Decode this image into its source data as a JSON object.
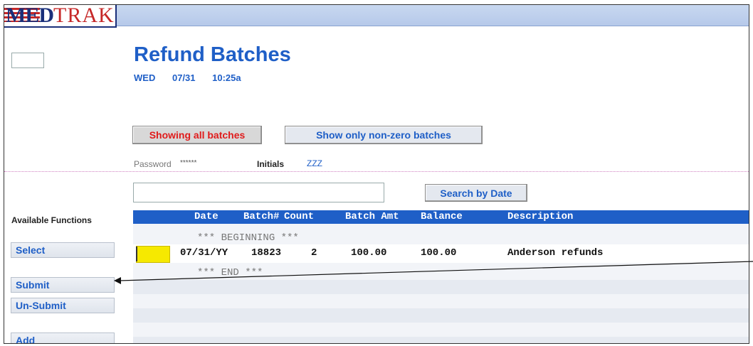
{
  "app": {
    "logo_med": "MED",
    "logo_trak": "TRAK"
  },
  "page": {
    "title": "Refund Batches",
    "day": "WED",
    "date": "07/31",
    "time": "10:25a"
  },
  "filters": {
    "showing_all_label": "Showing all batches",
    "non_zero_label": "Show only non-zero batches"
  },
  "credentials": {
    "password_label": "Password",
    "password_value": "******",
    "initials_label": "Initials",
    "initials_value": "ZZZ"
  },
  "search": {
    "input_value": "",
    "button_label": "Search by Date"
  },
  "functions": {
    "heading": "Available Functions",
    "select": "Select",
    "submit": "Submit",
    "unsubmit": "Un-Submit",
    "add": "Add"
  },
  "table": {
    "columns": [
      "Date",
      "Batch#",
      "Count",
      "Batch Amt",
      "Balance",
      "Description"
    ],
    "beginning_marker": "*** BEGINNING ***",
    "end_marker": "*** END ***",
    "rows": [
      {
        "date": "07/31/YY",
        "batch": "18823",
        "count": "2",
        "batch_amt": "100.00",
        "balance": "100.00",
        "description": "Anderson refunds"
      }
    ]
  },
  "colors": {
    "accent_blue": "#1f5fc7",
    "alert_red": "#e01b1b",
    "selected_yellow": "#f6e900"
  }
}
